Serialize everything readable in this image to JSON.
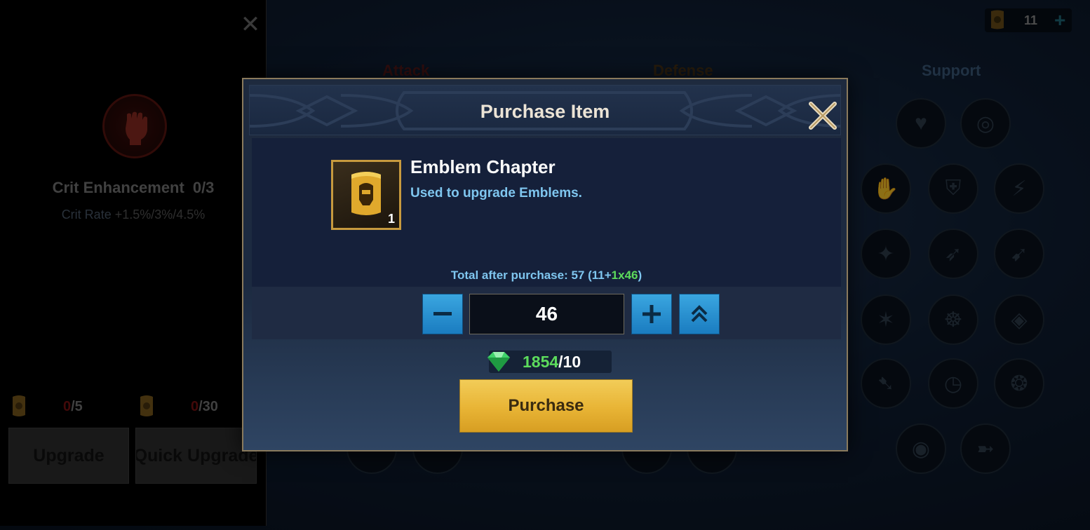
{
  "left_panel": {
    "close_label": "✕",
    "talent_name": "Crit Enhancement",
    "talent_level": "0/3",
    "talent_desc_label": "Crit Rate",
    "talent_desc_value": "+1.5%/3%/4.5%",
    "cost_1_have": "0",
    "cost_1_need": "/5",
    "cost_2_have": "0",
    "cost_2_need": "/30",
    "upgrade_label": "Upgrade",
    "quick_upgrade_label": "Quick Upgrade"
  },
  "categories": {
    "attack": "Attack",
    "defense": "Defense",
    "support": "Support"
  },
  "currency": {
    "icon": "scroll-icon",
    "count": "11",
    "plus": "+"
  },
  "modal": {
    "title": "Purchase Item",
    "item": {
      "icon": "emblem-scroll-icon",
      "name": "Emblem Chapter",
      "description": "Used to upgrade Emblems.",
      "quantity_badge": "1"
    },
    "total": {
      "prefix": "Total after purchase: 57 (11+",
      "added": "1x46",
      "suffix": ")"
    },
    "quantity": {
      "minus": "−",
      "value": "46",
      "plus": "+",
      "max": "⌃"
    },
    "price": {
      "icon": "diamond-icon",
      "have": "1854",
      "need": "/10"
    },
    "purchase_label": "Purchase"
  },
  "colors": {
    "accent_blue": "#2a92d4",
    "gold": "#e8b435",
    "green": "#5cdb5c",
    "light_blue_text": "#7fc6ef"
  }
}
